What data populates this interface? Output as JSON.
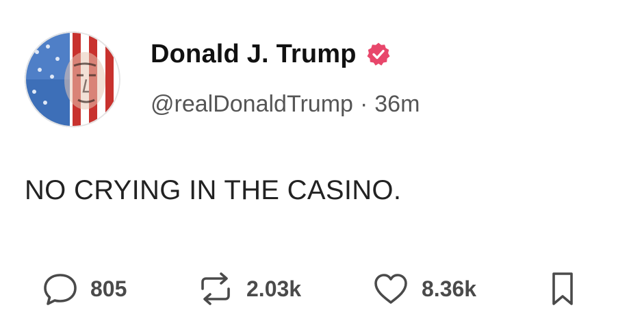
{
  "post": {
    "author": {
      "display_name": "Donald J. Trump",
      "handle": "@realDonaldTrump",
      "verified": true
    },
    "separator": "·",
    "time_ago": "36m",
    "text": "NO CRYING IN THE CASINO.",
    "actions": {
      "replies": "805",
      "reposts": "2.03k",
      "likes": "8.36k"
    }
  },
  "icons": {
    "reply": "speech-bubble-icon",
    "repost": "repost-arrows-icon",
    "like": "heart-icon",
    "bookmark": "bookmark-icon",
    "verified": "verified-badge-icon"
  },
  "colors": {
    "verified_badge": "#e8476b",
    "text": "#222222",
    "secondary_text": "#555555",
    "icon": "#4a4a4a"
  }
}
